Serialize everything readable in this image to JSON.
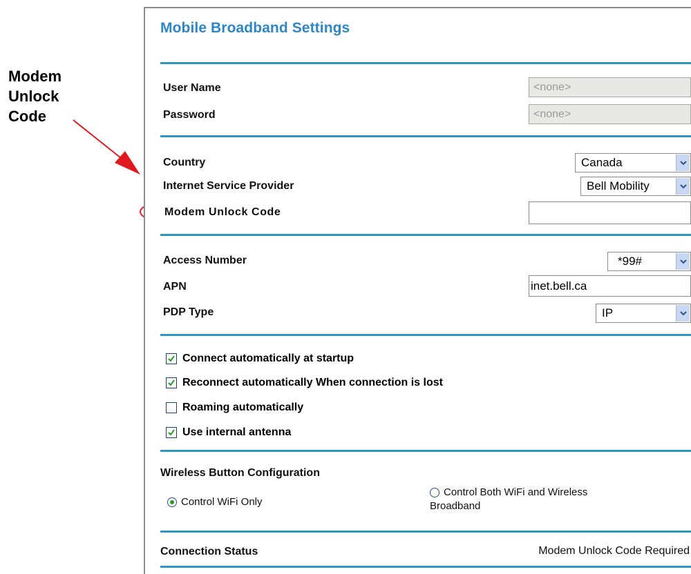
{
  "callout": {
    "lines": [
      "Modem",
      "Unlock",
      "Code"
    ],
    "arrow_color": "#e0191e",
    "ellipse_color": "#d8232a"
  },
  "panel": {
    "title": "Mobile Broadband Settings",
    "accent_color": "#2f95c2",
    "login": {
      "user_name_label": "User Name",
      "user_name_value": "<none>",
      "password_label": "Password",
      "password_value": "<none>"
    },
    "provider": {
      "country_label": "Country",
      "country_value": "Canada",
      "isp_label": "Internet Service Provider",
      "isp_value": "Bell Mobility",
      "unlock_label": "Modem Unlock Code",
      "unlock_value": ""
    },
    "connection": {
      "access_number_label": "Access Number",
      "access_number_value": "*99#",
      "apn_label": "APN",
      "apn_value": "inet.bell.ca",
      "pdp_label": "PDP Type",
      "pdp_value": "IP"
    },
    "options": [
      {
        "label": "Connect automatically at startup",
        "checked": true
      },
      {
        "label": "Reconnect automatically When connection is lost",
        "checked": true
      },
      {
        "label": "Roaming automatically",
        "checked": false
      },
      {
        "label": "Use internal antenna",
        "checked": true
      }
    ],
    "wireless_button": {
      "heading": "Wireless Button Configuration",
      "option_wifi_only": "Control WiFi Only",
      "option_both_line1": "Control Both WiFi and Wireless",
      "option_both_line2": "Broadband",
      "selected": "Control WiFi Only"
    },
    "status": {
      "label": "Connection Status",
      "value": "Modem Unlock Code Required"
    }
  }
}
